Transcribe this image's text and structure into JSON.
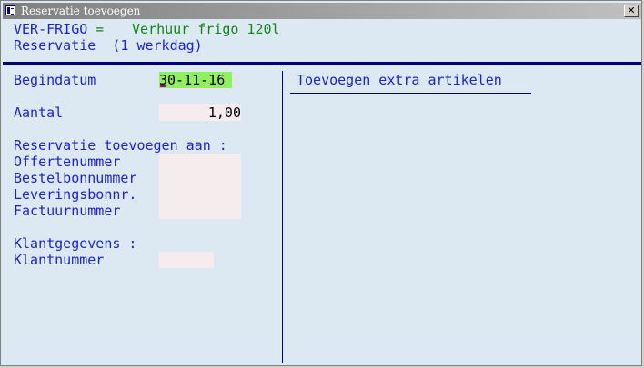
{
  "window": {
    "title": "Reservatie toevoegen",
    "close_glyph": "✕"
  },
  "header": {
    "code": "VER-FRIGO",
    "equals": " = ",
    "description": "Verhuur frigo 120l",
    "subtitle": "Reservatie  (1 werkdag)"
  },
  "form": {
    "begindatum_label": "Begindatum",
    "begindatum_value": "30-11-16",
    "aantal_label": "Aantal",
    "aantal_value": "1,00",
    "section_add_to": "Reservatie toevoegen aan :",
    "offertenummer_label": "Offertenummer",
    "bestelbonnummer_label": "Bestelbonnummer",
    "leveringsbonnr_label": "Leveringsbonnr.",
    "factuurnummer_label": "Factuurnummer",
    "section_klant": "Klantgegevens :",
    "klantnummer_label": "Klantnummer"
  },
  "right_panel": {
    "title": "Toevoegen extra artikelen"
  },
  "colors": {
    "background": "#dce8f2",
    "label_blue": "#1c24c8",
    "value_green": "#12851b",
    "active_field": "#90ee60",
    "input_field": "#f6ecee",
    "separator": "#000080"
  }
}
